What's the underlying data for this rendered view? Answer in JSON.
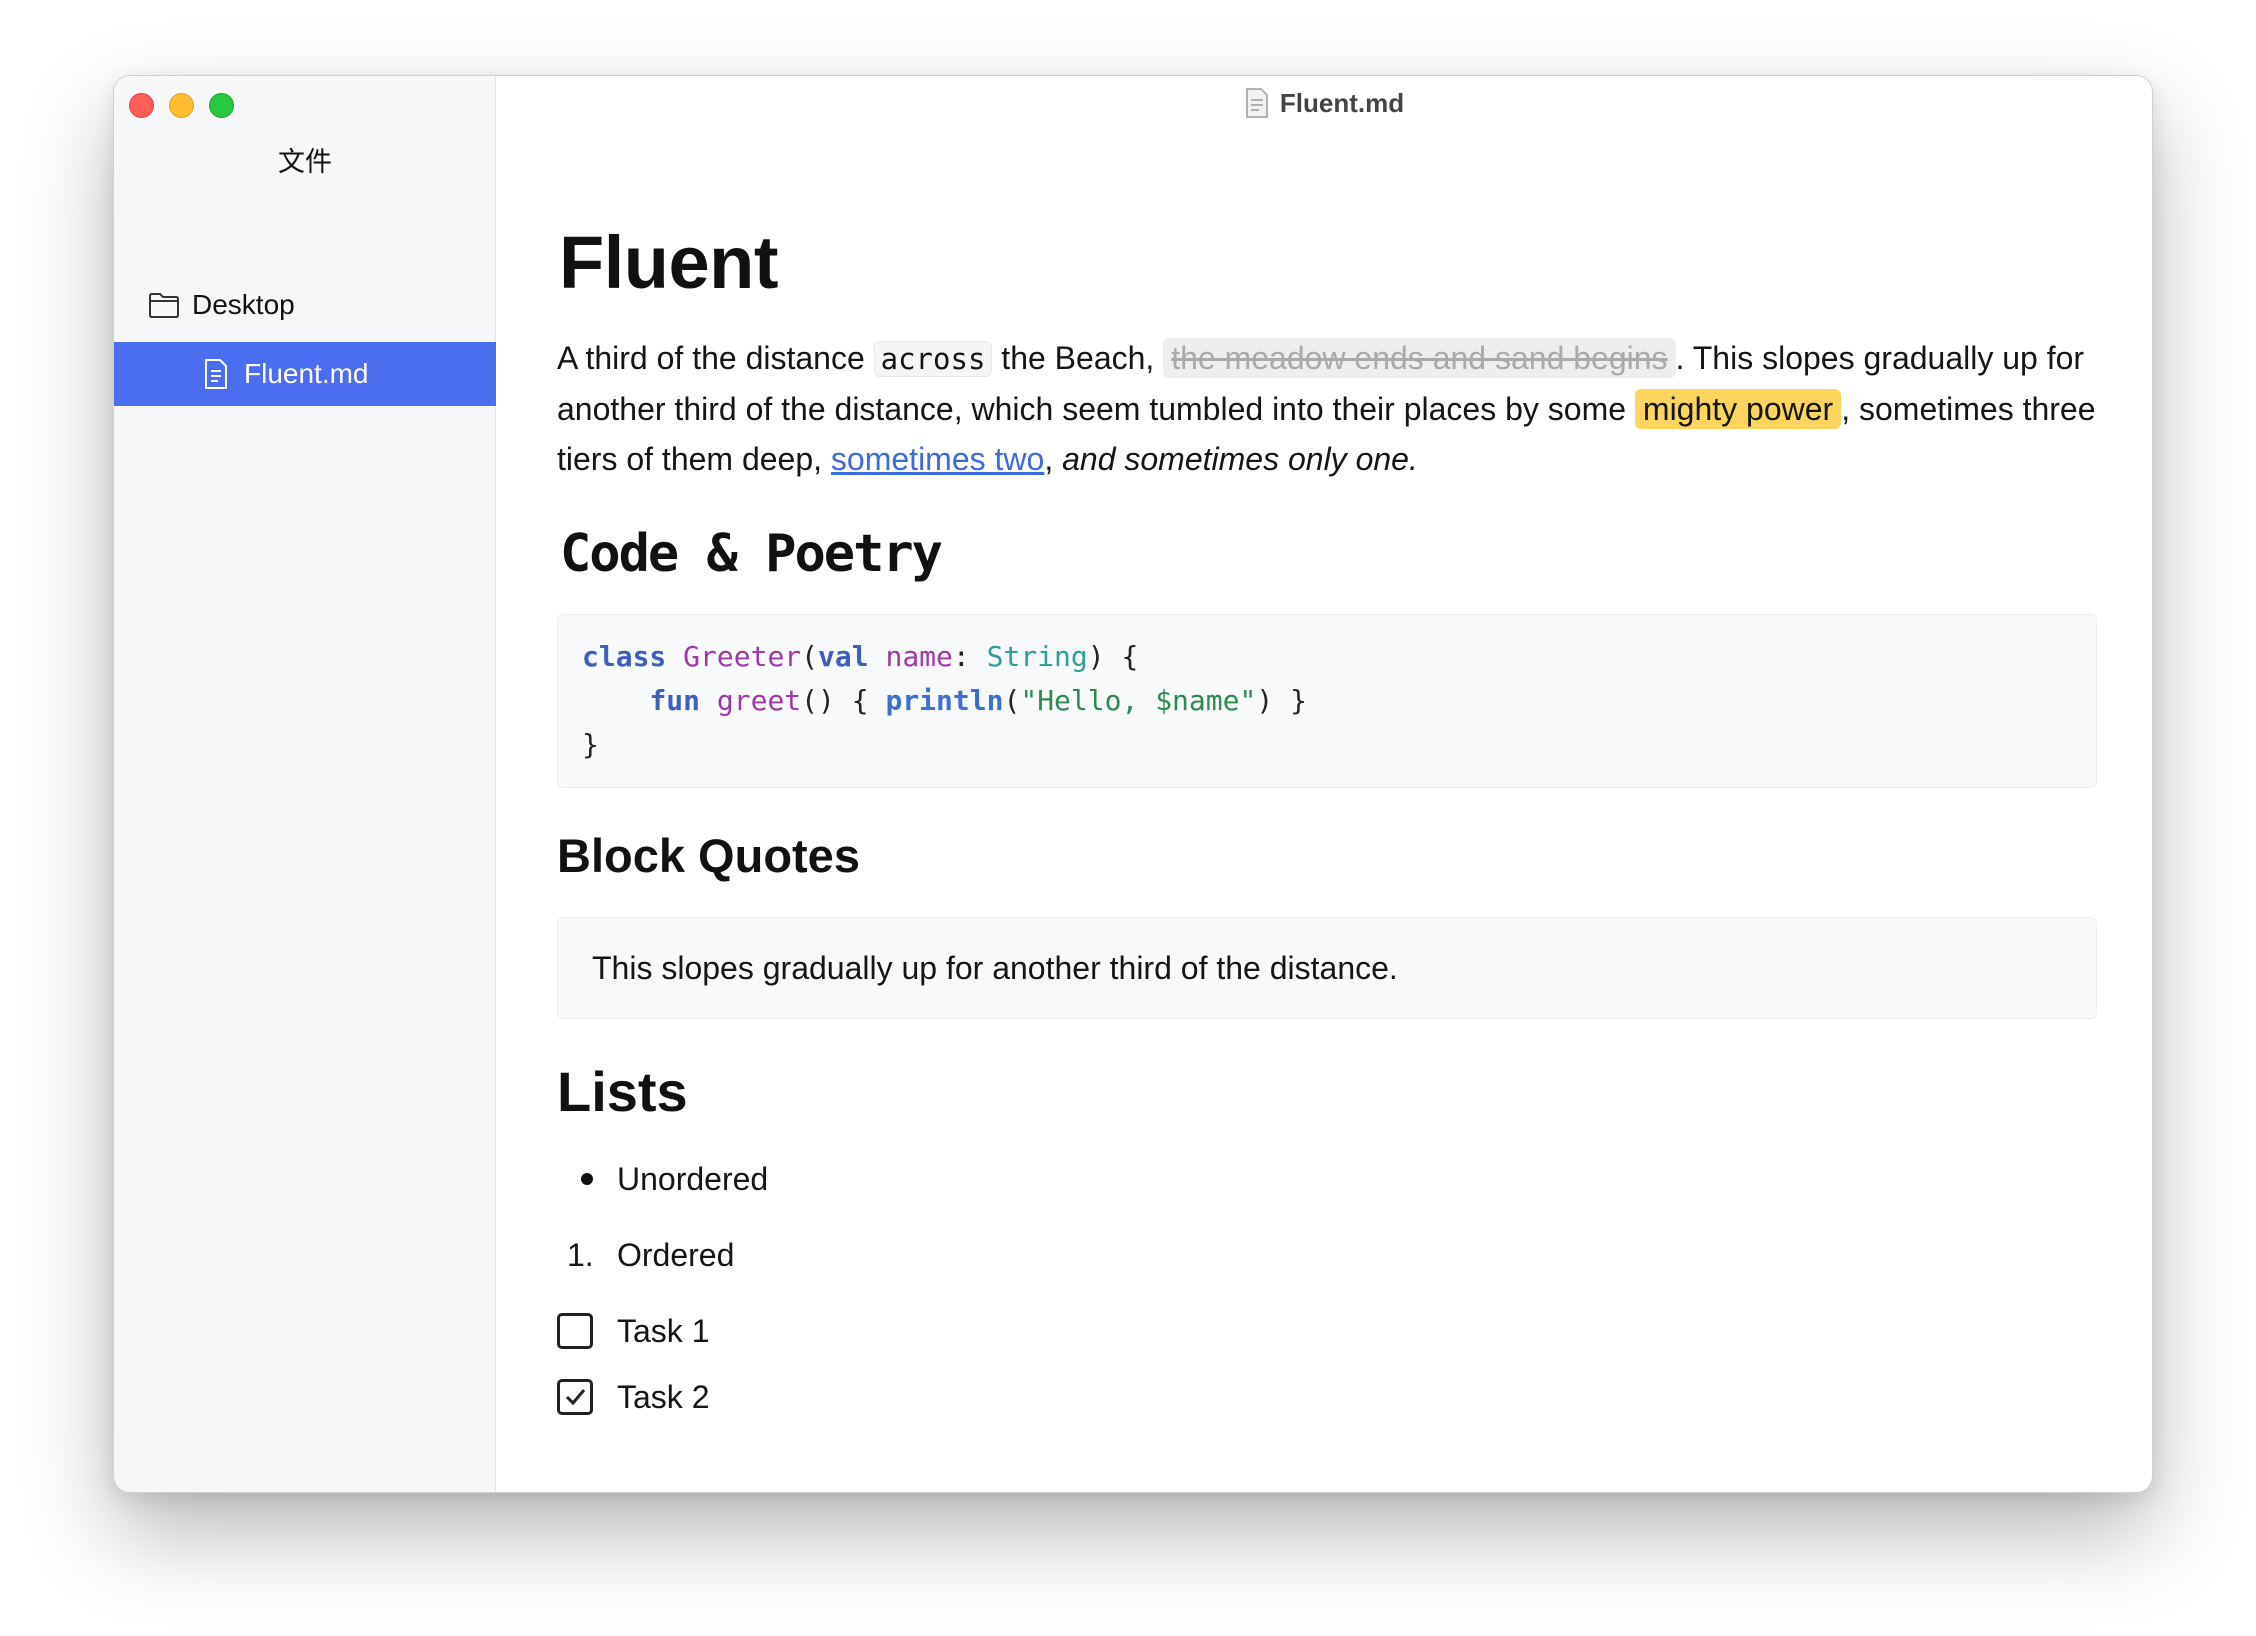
{
  "window": {
    "title": "Fluent.md"
  },
  "sidebar": {
    "title": "文件",
    "folder": {
      "label": "Desktop",
      "icon": "folder-icon"
    },
    "file": {
      "label": "Fluent.md",
      "icon": "document-icon",
      "selected": true
    }
  },
  "doc": {
    "title": "Fluent",
    "para": {
      "t1": "A third of the distance ",
      "code": "across",
      "t2": " the Beach, ",
      "strike": "the meadow ends and sand begins",
      "t3": ". This slopes gradually up for another third of the distance, which seem tumbled into their places by some ",
      "mark": "mighty power",
      "t4": ", sometimes three tiers of them deep, ",
      "link": "sometimes two",
      "t5": ", ",
      "italic": "and sometimes only one."
    },
    "code_heading": "Code & Poetry",
    "code": {
      "l1": {
        "kw1": "class",
        "cls": "Greeter",
        "p1": "(",
        "kw2": "val",
        "sp": " ",
        "prm": "name",
        "p2": ": ",
        "typ": "String",
        "p3": ") {"
      },
      "l2": {
        "indent": "    ",
        "kw": "fun",
        "sp": " ",
        "fn": "greet",
        "p1": "() { ",
        "call": "println",
        "p2": "(",
        "str": "\"Hello, $name\"",
        "p3": ") }"
      },
      "l3": "}"
    },
    "quote_heading": "Block Quotes",
    "quote": "This slopes gradually up for another third of the distance.",
    "lists_heading": "Lists",
    "unordered_item": "Unordered",
    "ordered_marker": "1.",
    "ordered_item": "Ordered",
    "tasks": [
      {
        "label": "Task 1",
        "checked": false
      },
      {
        "label": "Task 2",
        "checked": true
      }
    ]
  },
  "colors": {
    "selection": "#4a6ef0",
    "highlight": "#fdd55e",
    "link": "#3b6bdc",
    "keyword": "#3e5fbe",
    "class_name": "#9d39a8",
    "type": "#2e9e9a",
    "string": "#2e8a53"
  }
}
